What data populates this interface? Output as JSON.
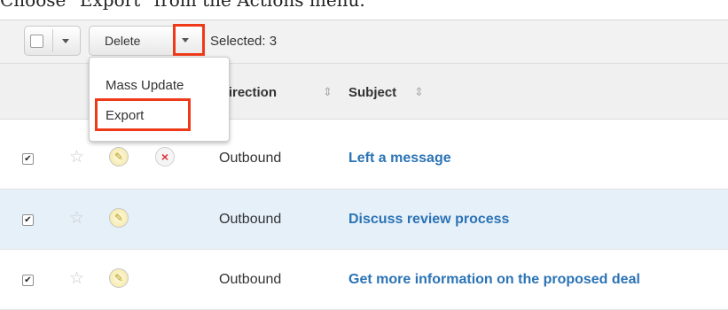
{
  "caption": "Choose \"Export\" from the Actions menu.",
  "toolbar": {
    "delete_label": "Delete",
    "selected_label": "Selected: 3"
  },
  "actions_menu": {
    "items": [
      {
        "label": "Mass Update"
      },
      {
        "label": "Export"
      }
    ]
  },
  "table": {
    "columns": [
      {
        "label": "Direction"
      },
      {
        "label": "Subject"
      }
    ],
    "rows": [
      {
        "checked": true,
        "direction": "Outbound",
        "subject": "Left a message"
      },
      {
        "checked": true,
        "direction": "Outbound",
        "subject": "Discuss review process"
      },
      {
        "checked": true,
        "direction": "Outbound",
        "subject": "Get more information on the proposed deal"
      }
    ]
  },
  "colors": {
    "highlight": "#ef3a1a",
    "link": "#2b73b5",
    "selected_row": "#e6f0f9"
  }
}
